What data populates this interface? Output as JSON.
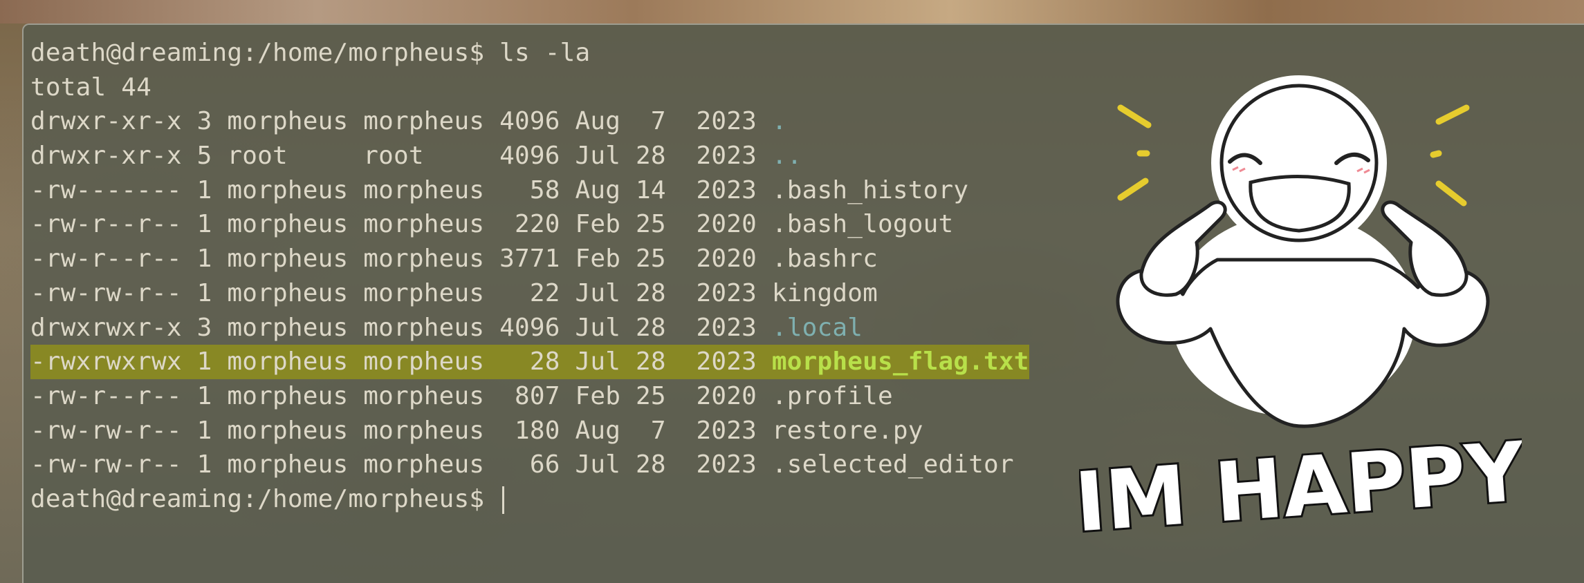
{
  "terminal": {
    "command_line": "death@dreaming:/home/morpheus$ ls -la",
    "total_line": "total 44",
    "rows": [
      {
        "meta": "drwxr-xr-x 3 morpheus morpheus 4096 Aug  7  2023 ",
        "name": ".",
        "kind": "dir"
      },
      {
        "meta": "drwxr-xr-x 5 root     root     4096 Jul 28  2023 ",
        "name": "..",
        "kind": "dir"
      },
      {
        "meta": "-rw------- 1 morpheus morpheus   58 Aug 14  2023 ",
        "name": ".bash_history",
        "kind": "file"
      },
      {
        "meta": "-rw-r--r-- 1 morpheus morpheus  220 Feb 25  2020 ",
        "name": ".bash_logout",
        "kind": "file"
      },
      {
        "meta": "-rw-r--r-- 1 morpheus morpheus 3771 Feb 25  2020 ",
        "name": ".bashrc",
        "kind": "file"
      },
      {
        "meta": "-rw-rw-r-- 1 morpheus morpheus   22 Jul 28  2023 ",
        "name": "kingdom",
        "kind": "file"
      },
      {
        "meta": "drwxrwxr-x 3 morpheus morpheus 4096 Jul 28  2023 ",
        "name": ".local",
        "kind": "dir"
      },
      {
        "meta": "-rwxrwxrwx 1 morpheus morpheus   28 Jul 28  2023 ",
        "name": "morpheus_flag.txt",
        "kind": "exec",
        "highlighted": true
      },
      {
        "meta": "-rw-r--r-- 1 morpheus morpheus  807 Feb 25  2020 ",
        "name": ".profile",
        "kind": "file"
      },
      {
        "meta": "-rw-rw-r-- 1 morpheus morpheus  180 Aug  7  2023 ",
        "name": "restore.py",
        "kind": "file"
      },
      {
        "meta": "-rw-rw-r-- 1 morpheus morpheus   66 Jul 28  2023 ",
        "name": ".selected_editor",
        "kind": "file"
      }
    ],
    "prompt": "death@dreaming:/home/morpheus$ "
  },
  "sticker": {
    "caption": "IM HAPPY"
  },
  "colors": {
    "terminal_text": "#ddd8c8",
    "dir": "#7fb0b0",
    "exec": "#b8e04a",
    "highlight": "#aaaa00"
  }
}
